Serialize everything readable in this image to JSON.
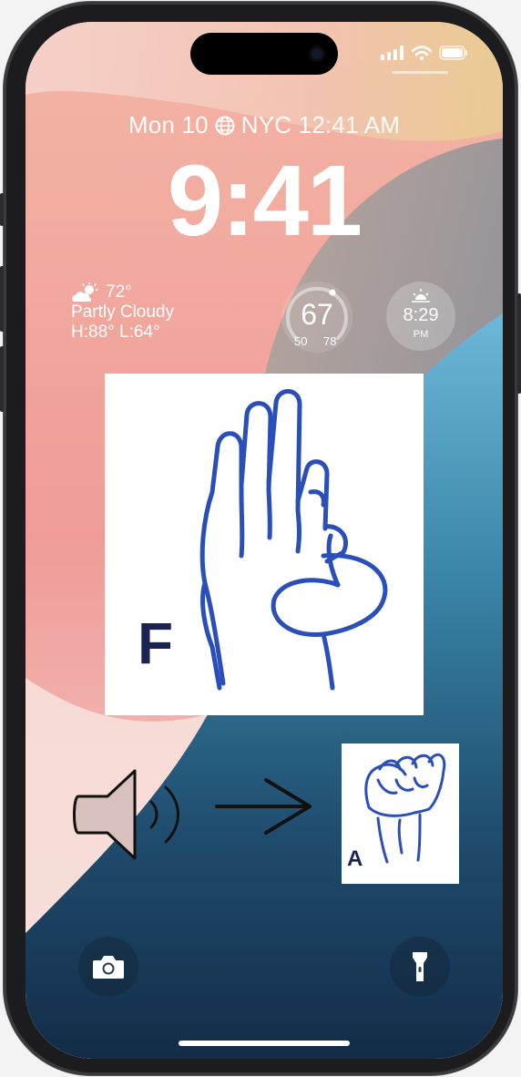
{
  "lock_screen": {
    "date_line": "Mon 10",
    "world_clock": "NYC 12:41 AM",
    "time": "9:41"
  },
  "weather": {
    "temperature": "72°",
    "condition": "Partly Cloudy",
    "high_low": "H:88° L:64°",
    "icon": "partly-cloudy-icon"
  },
  "temperature_gauge": {
    "current": "67",
    "low": "50",
    "high": "78"
  },
  "sunset_widget": {
    "time": "8:29",
    "period": "PM",
    "icon": "sunset-icon"
  },
  "sign_language": {
    "large_letter": "F",
    "small_letter": "A"
  },
  "quick_actions": {
    "camera_icon": "camera-icon",
    "flashlight_icon": "flashlight-icon"
  },
  "colors": {
    "sign_blue": "#2a4fb8",
    "letter_navy": "#1c2350"
  }
}
